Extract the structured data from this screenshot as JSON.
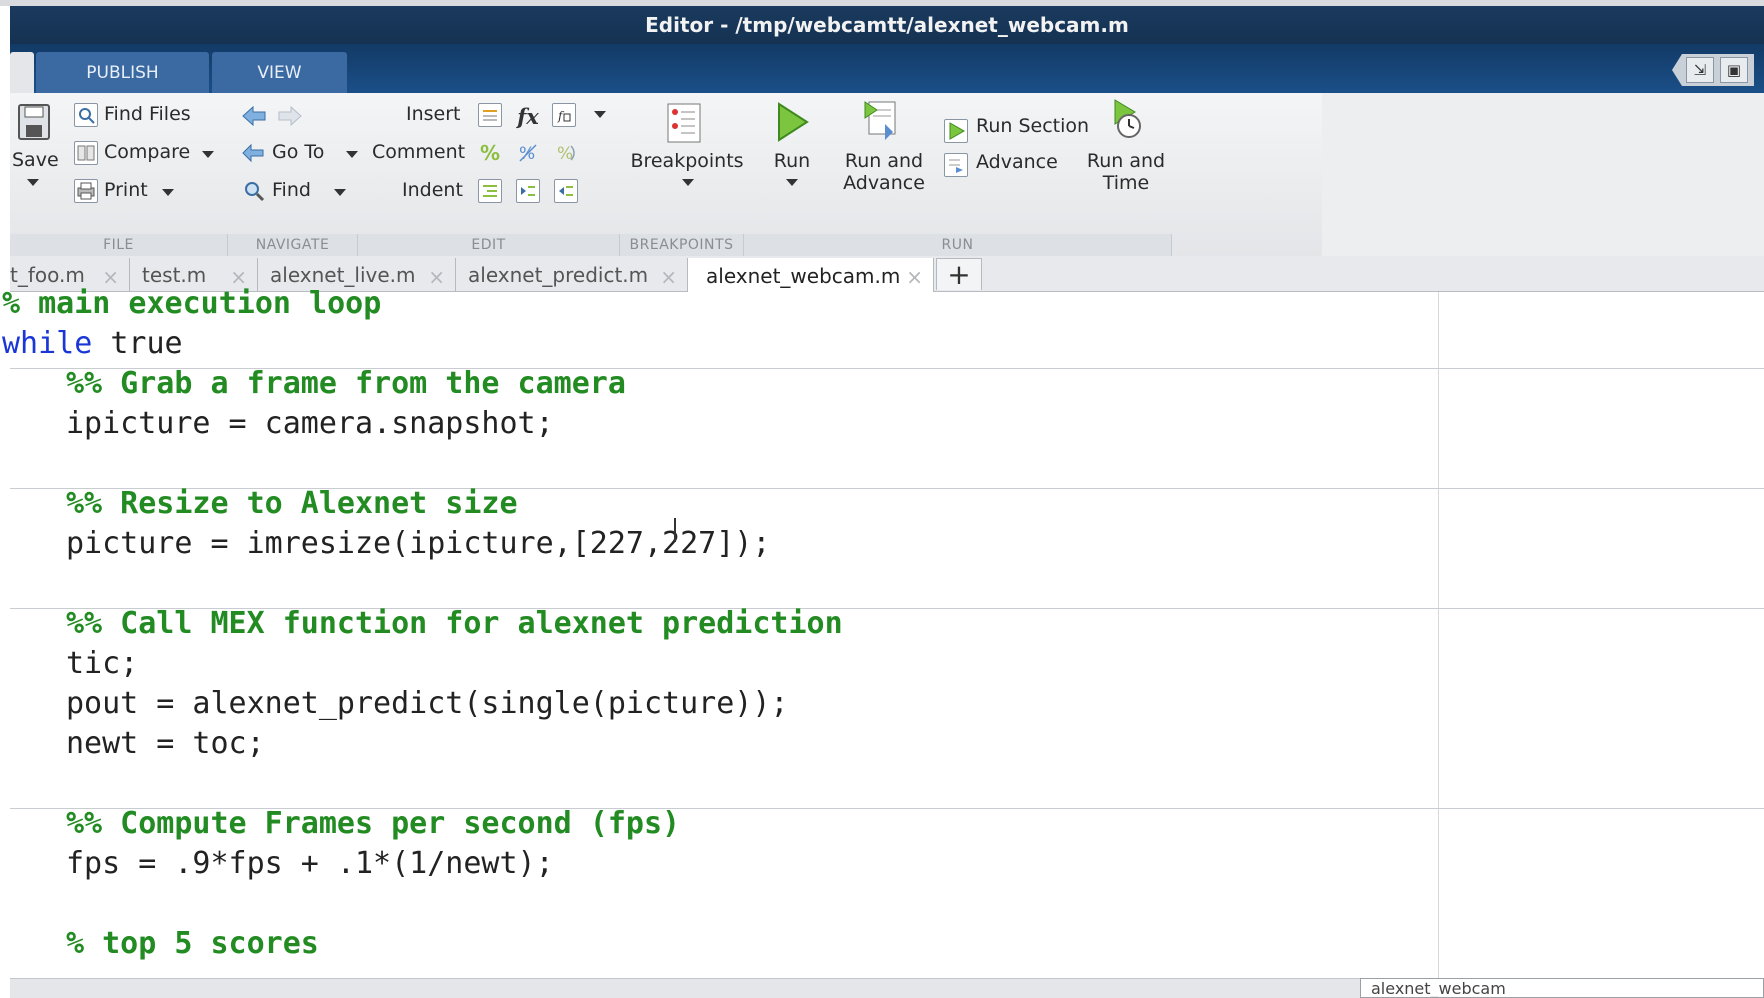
{
  "window": {
    "title": "Editor - /tmp/webcamtt/alexnet_webcam.m"
  },
  "ribbon_tabs": [
    {
      "label": "PUBLISH"
    },
    {
      "label": "VIEW"
    }
  ],
  "ribbon": {
    "file": {
      "label": "FILE",
      "save": "Save",
      "find_files": "Find Files",
      "compare": "Compare",
      "print": "Print"
    },
    "navigate": {
      "label": "NAVIGATE",
      "go_to": "Go To",
      "find": "Find"
    },
    "edit": {
      "label": "EDIT",
      "insert": "Insert",
      "comment": "Comment",
      "indent": "Indent",
      "fx": "fx"
    },
    "breakpoints": {
      "label": "BREAKPOINTS",
      "breakpoints": "Breakpoints"
    },
    "run": {
      "label": "RUN",
      "run": "Run",
      "run_and_advance_1": "Run and",
      "run_and_advance_2": "Advance",
      "run_section": "Run Section",
      "advance": "Advance",
      "run_and_time_1": "Run and",
      "run_and_time_2": "Time"
    }
  },
  "doc_tabs": [
    {
      "label": "t_foo.m",
      "close": "×"
    },
    {
      "label": "test.m",
      "close": "×"
    },
    {
      "label": "alexnet_live.m",
      "close": "×"
    },
    {
      "label": "alexnet_predict.m",
      "close": "×"
    },
    {
      "label": "alexnet_webcam.m",
      "close": "×"
    }
  ],
  "new_tab": "+",
  "code": {
    "l1": "% main execution loop",
    "l2_kw": "while",
    "l2_rest": " true",
    "l3": "%% Grab a frame from the camera",
    "l4": "ipicture = camera.snapshot;",
    "l5": "%% Resize to Alexnet size",
    "l6": "picture = imresize(ipicture,[227,227]);",
    "l7": "%% Call MEX function for alexnet prediction",
    "l8": "tic;",
    "l9": "pout = alexnet_predict(single(picture));",
    "l10": "newt = toc;",
    "l11": "%% Compute Frames per second (fps)",
    "l12": "fps = .9*fps + .1*(1/newt);",
    "l13": "% top 5 scores"
  },
  "status": {
    "box_text": "alexnet_webcam"
  },
  "colors": {
    "keyword": "#1a37d6",
    "comment": "#228b22",
    "titlebar": "#1a3a5e"
  }
}
